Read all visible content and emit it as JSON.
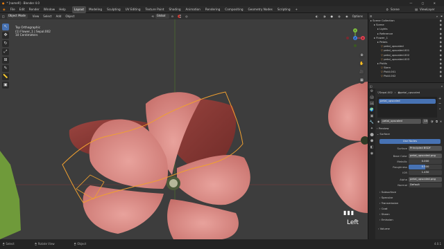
{
  "title": "* [name9] - Blender 4.0",
  "menu": {
    "items": [
      "File",
      "Edit",
      "Render",
      "Window",
      "Help"
    ],
    "workspaces": [
      "Layout",
      "Modeling",
      "Sculpting",
      "UV Editing",
      "Texture Paint",
      "Shading",
      "Animation",
      "Rendering",
      "Compositing",
      "Geometry Nodes",
      "Scripting"
    ],
    "active_workspace": "Layout",
    "add_tab": "+",
    "scene": "Scene",
    "view_layer": "ViewLayer"
  },
  "viewport_header": {
    "mode": "Object Mode",
    "menus": [
      "View",
      "Select",
      "Add",
      "Object"
    ],
    "transform": "Global",
    "options": "Options"
  },
  "viewport_info": {
    "line1": "Top Orthographic",
    "line2": "(1) Flower_1 | Sepal.002",
    "line3": "10 Centimeters"
  },
  "view_label": "Left",
  "gizmo": {
    "x": "X",
    "y": "Y",
    "z": "Z"
  },
  "outliner": {
    "items": [
      {
        "label": "Scene Collection",
        "indent": 0
      },
      {
        "label": "Scene",
        "indent": 1
      },
      {
        "label": "Lights",
        "indent": 2
      },
      {
        "label": "Reference",
        "indent": 2
      },
      {
        "label": "Flower_1",
        "indent": 1
      },
      {
        "label": "Petals",
        "indent": 2
      },
      {
        "label": "petal_upscaled",
        "indent": 3
      },
      {
        "label": "petal_upscaled.001",
        "indent": 3
      },
      {
        "label": "petal_upscaled.002",
        "indent": 3
      },
      {
        "label": "petal_upscaled.003",
        "indent": 3
      },
      {
        "label": "Pistils",
        "indent": 2
      },
      {
        "label": "Stem",
        "indent": 3
      },
      {
        "label": "Pistil.001",
        "indent": 3
      },
      {
        "label": "Pistil.002",
        "indent": 3
      }
    ]
  },
  "properties": {
    "object": "Sepal.002",
    "material_path": "petal_upscaled",
    "slot": "petal_upscaled",
    "material_name": "petal_upscaled",
    "users": "15",
    "sections": [
      "Preview",
      "Surface"
    ],
    "use_nodes": "Use Nodes",
    "surface_label": "Surface",
    "surface_value": "Principled BSDF",
    "base_color_label": "Base Color",
    "base_color_value": "petal_upscaled.png",
    "metallic_label": "Metallic",
    "metallic_value": "0.000",
    "roughness_label": "Roughness",
    "roughness_value": "0.500",
    "ior_label": "IOR",
    "ior_value": "1.450",
    "alpha_label": "Alpha",
    "alpha_value": "petal_upscaled.png",
    "normal_label": "Normal",
    "normal_value": "Default",
    "subsections": [
      "Subsurface",
      "Specular",
      "Transmission",
      "Coat",
      "Sheen",
      "Emission"
    ],
    "volume": "Volume"
  },
  "status": {
    "select": "Select",
    "rotate": "Rotate View",
    "object": "Object",
    "version": "4.0.1"
  },
  "colors": {
    "accent": "#4772b3",
    "selection_outline": "#f0a030",
    "petal": "#d98a84",
    "petal_dark": "#8a3a36",
    "leaf": "#6f9a3a"
  },
  "tools": [
    "cursor-icon",
    "move-icon",
    "rotate-icon",
    "scale-icon",
    "transform-icon",
    "annotate-icon",
    "measure-icon",
    "add-cube-icon"
  ]
}
